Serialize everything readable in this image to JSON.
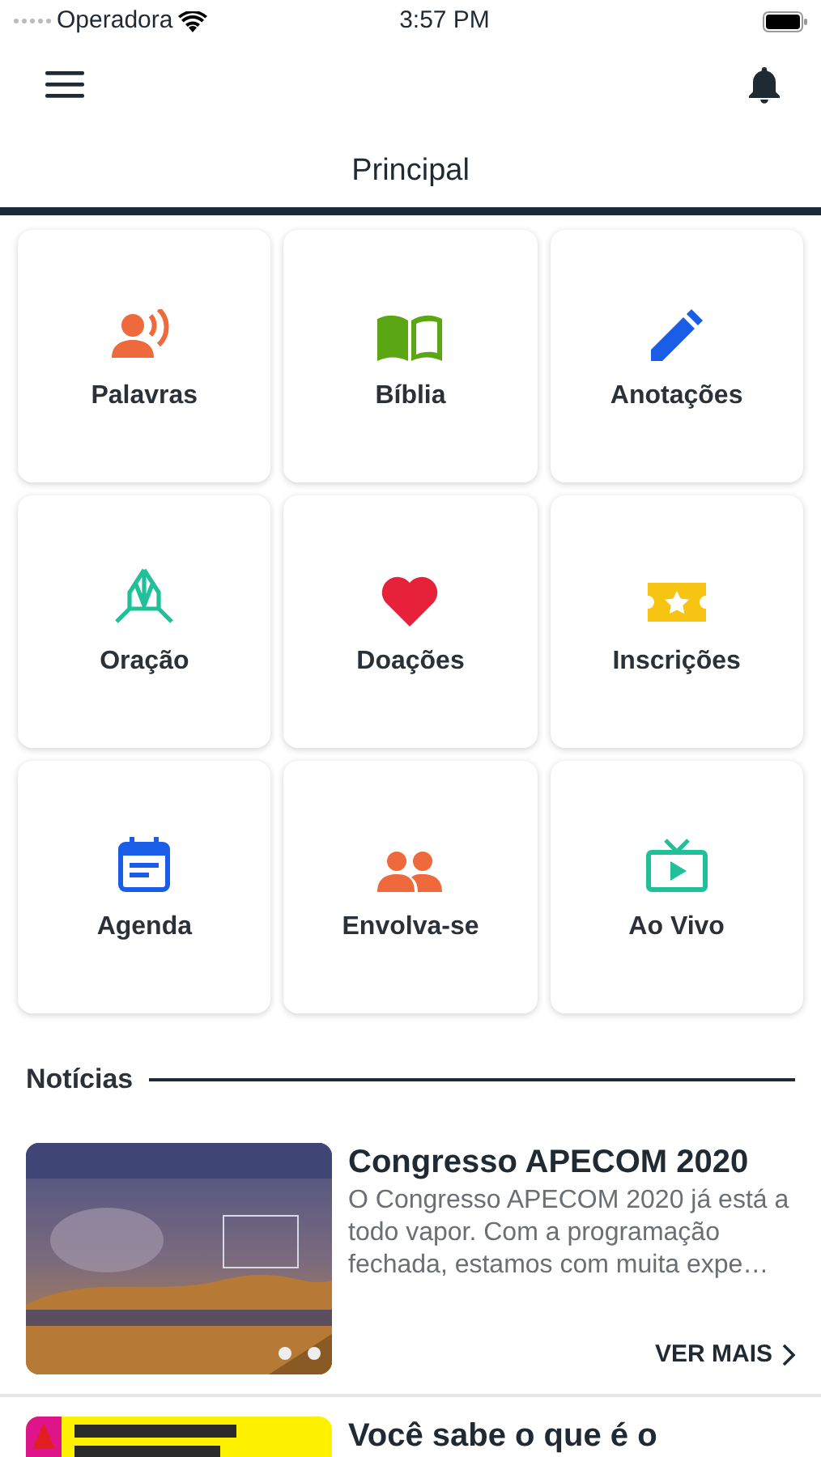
{
  "status_bar": {
    "carrier": "Operadora",
    "time": "3:57 PM"
  },
  "tabs": [
    {
      "label": "Principal",
      "selected": true
    }
  ],
  "tiles": [
    {
      "label": "Palavras"
    },
    {
      "label": "Bíblia"
    },
    {
      "label": "Anotações"
    },
    {
      "label": "Oração"
    },
    {
      "label": "Doações"
    },
    {
      "label": "Inscrições"
    },
    {
      "label": "Agenda"
    },
    {
      "label": "Envolva-se"
    },
    {
      "label": "Ao Vivo"
    }
  ],
  "news_section": {
    "title": "Notícias"
  },
  "news": [
    {
      "title": "Congresso APECOM 2020",
      "summary": "O Congresso APECOM 2020 já está a todo vapor. Com a programação fechada, estamos com muita expe…",
      "link": "VER MAIS"
    },
    {
      "title": "Você sabe o que é o"
    }
  ]
}
